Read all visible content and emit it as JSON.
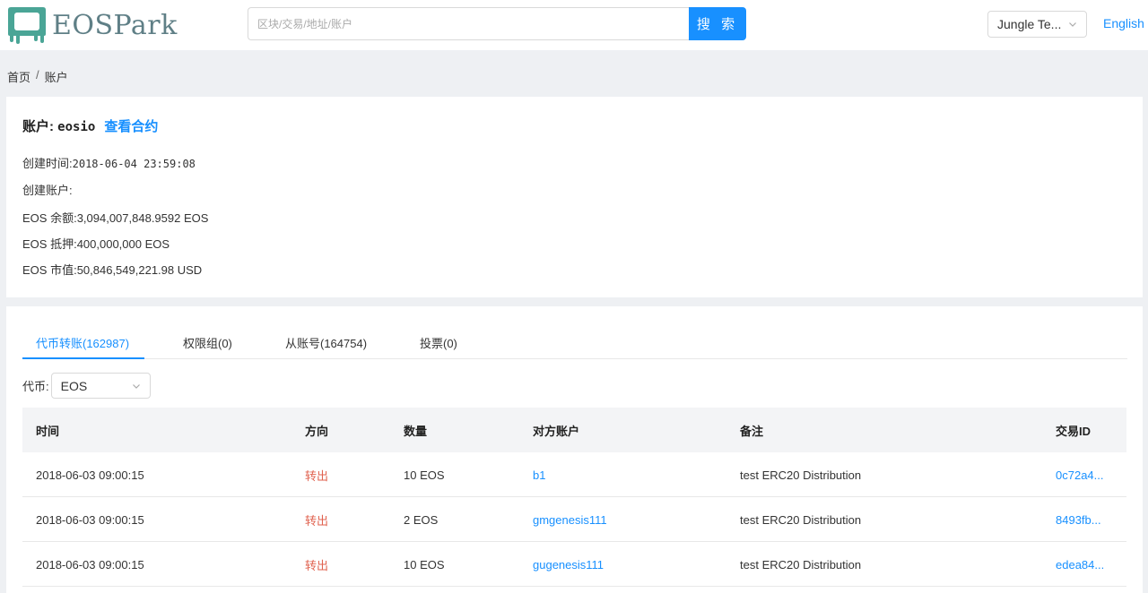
{
  "header": {
    "logo_text": "EOSPark",
    "search": {
      "placeholder": "区块/交易/地址/账户",
      "button_label": "搜 索"
    },
    "network_select": {
      "value": "Jungle Te..."
    },
    "language_link": "English"
  },
  "breadcrumb": {
    "home": "首页",
    "separator": "/",
    "current": "账户"
  },
  "account": {
    "label": "账户:",
    "name": "eosio",
    "view_contract": "查看合约",
    "created_time_label": "创建时间:",
    "created_time": "2018-06-04 23:59:08",
    "creator_label": "创建账户:",
    "creator": "",
    "balance_label": "EOS 余额:",
    "balance": "3,094,007,848.9592 EOS",
    "staked_label": "EOS 抵押:",
    "staked": "400,000,000 EOS",
    "market_value_label": "EOS 市值:",
    "market_value": "50,846,549,221.98 USD"
  },
  "tabs": [
    {
      "label": "代币转账(162987)",
      "active": true
    },
    {
      "label": "权限组(0)",
      "active": false
    },
    {
      "label": "从账号(164754)",
      "active": false
    },
    {
      "label": "投票(0)",
      "active": false
    }
  ],
  "filter": {
    "label": "代币:",
    "value": "EOS"
  },
  "table": {
    "headers": {
      "time": "时间",
      "direction": "方向",
      "amount": "数量",
      "counterparty": "对方账户",
      "memo": "备注",
      "tx_id": "交易ID"
    },
    "rows": [
      {
        "time": "2018-06-03 09:00:15",
        "direction": "转出",
        "amount": "10 EOS",
        "counterparty": "b1",
        "memo": "test ERC20 Distribution",
        "tx_id": "0c72a4..."
      },
      {
        "time": "2018-06-03 09:00:15",
        "direction": "转出",
        "amount": "2 EOS",
        "counterparty": "gmgenesis111",
        "memo": "test ERC20 Distribution",
        "tx_id": "8493fb..."
      },
      {
        "time": "2018-06-03 09:00:15",
        "direction": "转出",
        "amount": "10 EOS",
        "counterparty": "gugenesis111",
        "memo": "test ERC20 Distribution",
        "tx_id": "edea84..."
      }
    ]
  },
  "colors": {
    "accent": "#1890ff",
    "outgoing": "#e0624f",
    "logo": "#4aa596"
  }
}
